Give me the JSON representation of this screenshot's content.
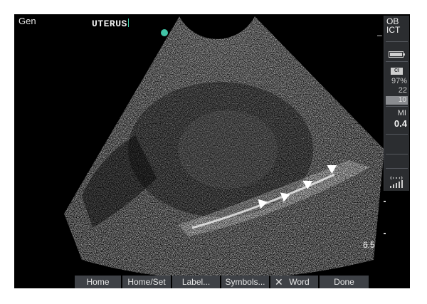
{
  "mode": "Gen",
  "annotation": "UTERUS",
  "status_panel": {
    "preset_line1": "OB",
    "preset_line2": "ICT",
    "depth_dash": "–",
    "battery_level": 1.0,
    "ci_badge": "CI",
    "contrast": "97%",
    "value1": "22",
    "value2": "10",
    "mi_label": "MI",
    "mi_value": "0.4"
  },
  "depth": "6.5",
  "softkeys": [
    "Home",
    "Home/Set",
    "Label...",
    "Symbols...",
    "Word",
    "Done"
  ],
  "colors": {
    "marker": "#41c4a6",
    "panel": "#2b2d30",
    "softkey": "#3e4146"
  },
  "icons": [
    "battery-icon",
    "signal-icon",
    "close-icon",
    "arrowhead-icon"
  ]
}
